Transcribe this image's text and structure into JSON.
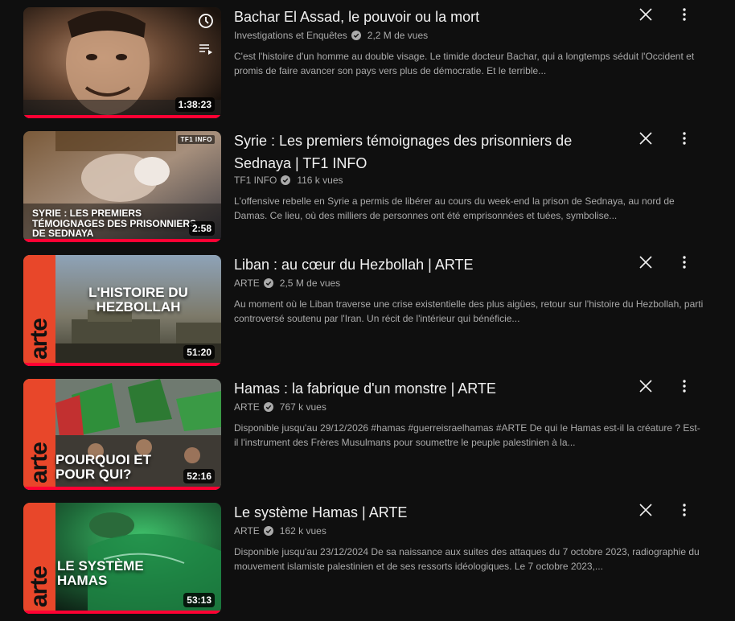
{
  "colors": {
    "background": "#0f0f0f",
    "title": "#f1f1f1",
    "secondary": "#aaaaaa",
    "progress": "#ff0033",
    "arte": "#e8472a"
  },
  "videos": [
    {
      "title": "Bachar El Assad, le pouvoir ou la mort",
      "channel": "Investigations et Enquêtes",
      "views": "2,2 M de vues",
      "description": "C'est l'histoire d'un homme au double visage. Le timide docteur Bachar, qui a longtemps séduit l'Occident et promis de faire avancer son pays vers plus de démocratie. Et le terrible...",
      "duration": "1:38:23",
      "watch_progress": 1.0,
      "thumb_caption": "",
      "icons": [
        "watch-later-icon",
        "add-to-queue-icon"
      ]
    },
    {
      "title": "Syrie : Les premiers témoignages des prisonniers de Sednaya | TF1 INFO",
      "channel": "TF1 INFO",
      "views": "116 k vues",
      "description": "L'offensive rebelle en Syrie a permis de libérer au cours du week-end la prison de Sednaya, au nord de Damas. Ce lieu, où des milliers de personnes ont été emprisonnées et tuées, symbolise...",
      "duration": "2:58",
      "watch_progress": 1.0,
      "thumb_caption": "SYRIE : LES PREMIERS TÉMOIGNAGES DES PRISONNIERS DE SEDNAYA",
      "badge": "TF1 INFO"
    },
    {
      "title": "Liban : au cœur du Hezbollah | ARTE",
      "channel": "ARTE",
      "views": "2,5 M de vues",
      "description": "Au moment où le Liban traverse une crise existentielle des plus aigües, retour sur l'histoire du Hezbollah, parti controversé soutenu par l'Iran. Un récit de l'intérieur qui bénéficie...",
      "duration": "51:20",
      "watch_progress": 1.0,
      "thumb_caption": "L'HISTOIRE DU HEZBOLLAH",
      "logo": "arte"
    },
    {
      "title": "Hamas : la fabrique d'un monstre | ARTE",
      "channel": "ARTE",
      "views": "767 k vues",
      "description": "Disponible jusqu'au 29/12/2026 #hamas #guerreisraelhamas #ARTE De qui le Hamas est-il la créature ? Est-il l'instrument des Frères Musulmans pour soumettre le peuple palestinien à la...",
      "duration": "52:16",
      "watch_progress": 1.0,
      "thumb_caption": "POURQUOI ET POUR QUI?",
      "logo": "arte"
    },
    {
      "title": "Le système Hamas | ARTE",
      "channel": "ARTE",
      "views": "162 k vues",
      "description": "Disponible jusqu'au 23/12/2024 De sa naissance aux suites des attaques du 7 octobre 2023, radiographie du mouvement islamiste palestinien et de ses ressorts idéologiques. Le 7 octobre 2023,...",
      "duration": "53:13",
      "watch_progress": 1.0,
      "thumb_caption": "LE SYSTÈME HAMAS",
      "logo": "arte"
    }
  ]
}
